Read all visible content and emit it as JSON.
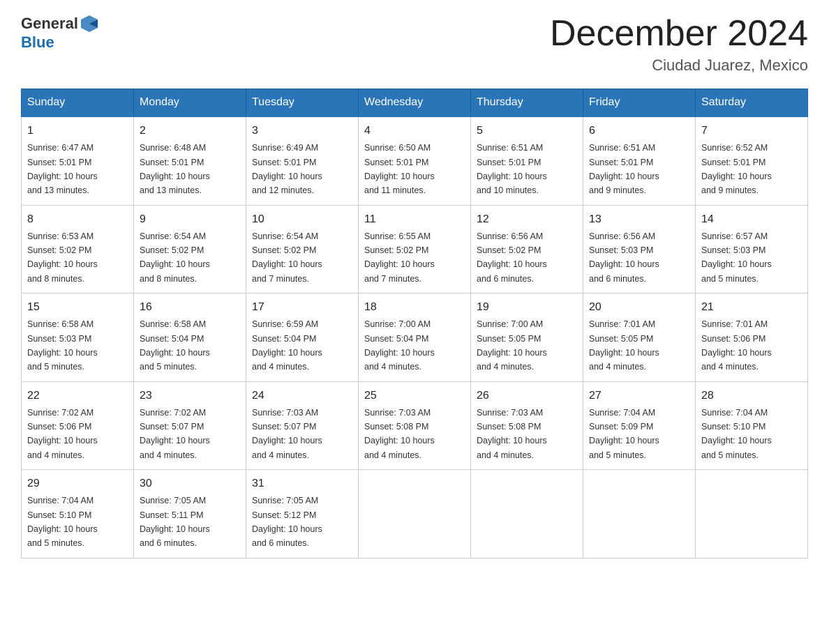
{
  "header": {
    "logo_general": "General",
    "logo_blue": "Blue",
    "month_title": "December 2024",
    "subtitle": "Ciudad Juarez, Mexico"
  },
  "weekdays": [
    "Sunday",
    "Monday",
    "Tuesday",
    "Wednesday",
    "Thursday",
    "Friday",
    "Saturday"
  ],
  "weeks": [
    [
      {
        "day": "1",
        "sunrise": "6:47 AM",
        "sunset": "5:01 PM",
        "daylight": "10 hours and 13 minutes."
      },
      {
        "day": "2",
        "sunrise": "6:48 AM",
        "sunset": "5:01 PM",
        "daylight": "10 hours and 13 minutes."
      },
      {
        "day": "3",
        "sunrise": "6:49 AM",
        "sunset": "5:01 PM",
        "daylight": "10 hours and 12 minutes."
      },
      {
        "day": "4",
        "sunrise": "6:50 AM",
        "sunset": "5:01 PM",
        "daylight": "10 hours and 11 minutes."
      },
      {
        "day": "5",
        "sunrise": "6:51 AM",
        "sunset": "5:01 PM",
        "daylight": "10 hours and 10 minutes."
      },
      {
        "day": "6",
        "sunrise": "6:51 AM",
        "sunset": "5:01 PM",
        "daylight": "10 hours and 9 minutes."
      },
      {
        "day": "7",
        "sunrise": "6:52 AM",
        "sunset": "5:01 PM",
        "daylight": "10 hours and 9 minutes."
      }
    ],
    [
      {
        "day": "8",
        "sunrise": "6:53 AM",
        "sunset": "5:02 PM",
        "daylight": "10 hours and 8 minutes."
      },
      {
        "day": "9",
        "sunrise": "6:54 AM",
        "sunset": "5:02 PM",
        "daylight": "10 hours and 8 minutes."
      },
      {
        "day": "10",
        "sunrise": "6:54 AM",
        "sunset": "5:02 PM",
        "daylight": "10 hours and 7 minutes."
      },
      {
        "day": "11",
        "sunrise": "6:55 AM",
        "sunset": "5:02 PM",
        "daylight": "10 hours and 7 minutes."
      },
      {
        "day": "12",
        "sunrise": "6:56 AM",
        "sunset": "5:02 PM",
        "daylight": "10 hours and 6 minutes."
      },
      {
        "day": "13",
        "sunrise": "6:56 AM",
        "sunset": "5:03 PM",
        "daylight": "10 hours and 6 minutes."
      },
      {
        "day": "14",
        "sunrise": "6:57 AM",
        "sunset": "5:03 PM",
        "daylight": "10 hours and 5 minutes."
      }
    ],
    [
      {
        "day": "15",
        "sunrise": "6:58 AM",
        "sunset": "5:03 PM",
        "daylight": "10 hours and 5 minutes."
      },
      {
        "day": "16",
        "sunrise": "6:58 AM",
        "sunset": "5:04 PM",
        "daylight": "10 hours and 5 minutes."
      },
      {
        "day": "17",
        "sunrise": "6:59 AM",
        "sunset": "5:04 PM",
        "daylight": "10 hours and 4 minutes."
      },
      {
        "day": "18",
        "sunrise": "7:00 AM",
        "sunset": "5:04 PM",
        "daylight": "10 hours and 4 minutes."
      },
      {
        "day": "19",
        "sunrise": "7:00 AM",
        "sunset": "5:05 PM",
        "daylight": "10 hours and 4 minutes."
      },
      {
        "day": "20",
        "sunrise": "7:01 AM",
        "sunset": "5:05 PM",
        "daylight": "10 hours and 4 minutes."
      },
      {
        "day": "21",
        "sunrise": "7:01 AM",
        "sunset": "5:06 PM",
        "daylight": "10 hours and 4 minutes."
      }
    ],
    [
      {
        "day": "22",
        "sunrise": "7:02 AM",
        "sunset": "5:06 PM",
        "daylight": "10 hours and 4 minutes."
      },
      {
        "day": "23",
        "sunrise": "7:02 AM",
        "sunset": "5:07 PM",
        "daylight": "10 hours and 4 minutes."
      },
      {
        "day": "24",
        "sunrise": "7:03 AM",
        "sunset": "5:07 PM",
        "daylight": "10 hours and 4 minutes."
      },
      {
        "day": "25",
        "sunrise": "7:03 AM",
        "sunset": "5:08 PM",
        "daylight": "10 hours and 4 minutes."
      },
      {
        "day": "26",
        "sunrise": "7:03 AM",
        "sunset": "5:08 PM",
        "daylight": "10 hours and 4 minutes."
      },
      {
        "day": "27",
        "sunrise": "7:04 AM",
        "sunset": "5:09 PM",
        "daylight": "10 hours and 5 minutes."
      },
      {
        "day": "28",
        "sunrise": "7:04 AM",
        "sunset": "5:10 PM",
        "daylight": "10 hours and 5 minutes."
      }
    ],
    [
      {
        "day": "29",
        "sunrise": "7:04 AM",
        "sunset": "5:10 PM",
        "daylight": "10 hours and 5 minutes."
      },
      {
        "day": "30",
        "sunrise": "7:05 AM",
        "sunset": "5:11 PM",
        "daylight": "10 hours and 6 minutes."
      },
      {
        "day": "31",
        "sunrise": "7:05 AM",
        "sunset": "5:12 PM",
        "daylight": "10 hours and 6 minutes."
      },
      null,
      null,
      null,
      null
    ]
  ],
  "labels": {
    "sunrise": "Sunrise:",
    "sunset": "Sunset:",
    "daylight": "Daylight:"
  }
}
